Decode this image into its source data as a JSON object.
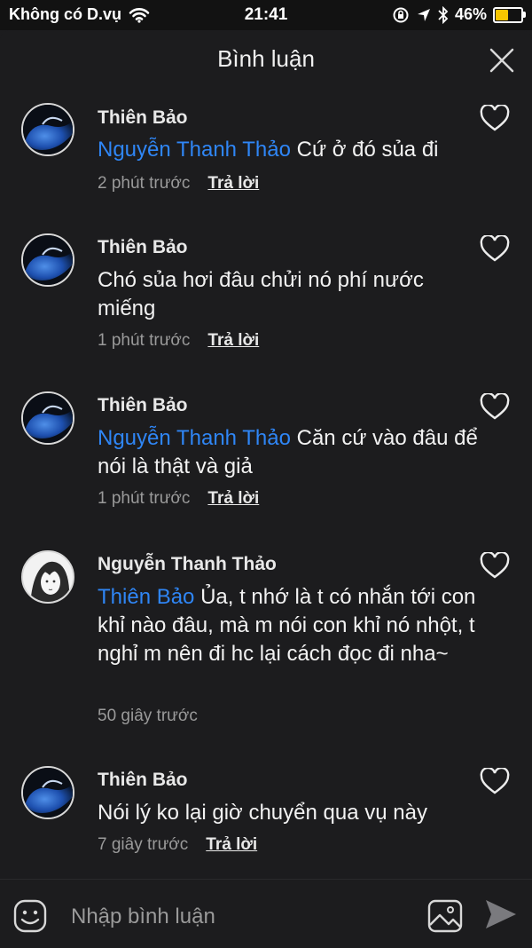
{
  "status_bar": {
    "carrier": "Không có D.vụ",
    "time": "21:41",
    "battery": "46%",
    "battery_level": 0.46,
    "icons": [
      "wifi-icon",
      "orientation-lock-icon",
      "location-icon",
      "bluetooth-icon",
      "battery-icon"
    ]
  },
  "header": {
    "title": "Bình luận",
    "close_icon": "close-icon"
  },
  "comments": [
    {
      "author": "Thiên Bảo",
      "mention": "Nguyễn Thanh Thảo",
      "text": " Cứ ở đó sủa đi",
      "time": "2 phút trước",
      "reply": "Trả lời"
    },
    {
      "author": "Thiên Bảo",
      "mention": "",
      "text": "Chó sủa hơi đâu chửi nó phí nước miếng",
      "time": "1 phút trước",
      "reply": "Trả lời"
    },
    {
      "author": "Thiên Bảo",
      "mention": "Nguyễn Thanh Thảo",
      "text": " Căn cứ vào đâu để nói là thật và giả",
      "time": "1 phút trước",
      "reply": "Trả lời"
    },
    {
      "author": "Nguyễn Thanh Thảo",
      "mention": "Thiên Bảo",
      "text": " Ủa, t nhớ là t có nhắn tới con khỉ nào đâu, mà m nói con khỉ nó nhột, t nghỉ m nên đi hc lại cách đọc đi nha~",
      "time": "50 giây trước",
      "reply": ""
    },
    {
      "author": "Thiên Bảo",
      "mention": "",
      "text": "Nói lý ko lại giờ chuyển qua vụ này",
      "time": "7 giây trước",
      "reply": "Trả lời"
    }
  ],
  "input_bar": {
    "placeholder": "Nhập bình luận",
    "icons": [
      "emoji-icon",
      "image-icon",
      "send-icon"
    ]
  },
  "colors": {
    "background": "#1c1c1e",
    "mention": "#2f86f6",
    "meta": "#9a9a9a",
    "battery": "#f7c500"
  }
}
